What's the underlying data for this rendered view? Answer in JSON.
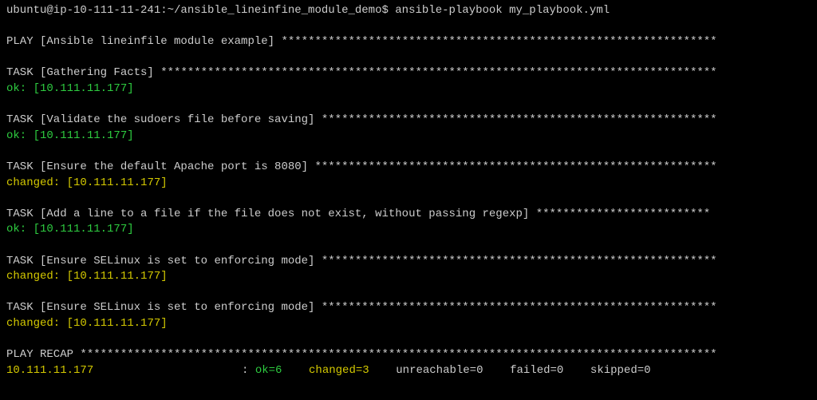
{
  "prompt": "ubuntu@ip-10-111-11-241:~/ansible_lineinfine_module_demo$ ansible-playbook my_playbook.yml",
  "play": {
    "label": "PLAY [Ansible lineinfile module example] ",
    "stars": "*****************************************************************"
  },
  "tasks": [
    {
      "label": "TASK [Gathering Facts] ",
      "stars": "***********************************************************************************",
      "status": "ok",
      "host": "[10.111.11.177]"
    },
    {
      "label": "TASK [Validate the sudoers file before saving] ",
      "stars": "***********************************************************",
      "status": "ok",
      "host": "[10.111.11.177]"
    },
    {
      "label": "TASK [Ensure the default Apache port is 8080] ",
      "stars": "************************************************************",
      "status": "changed",
      "host": "[10.111.11.177]"
    },
    {
      "label": "TASK [Add a line to a file if the file does not exist, without passing regexp] ",
      "stars": "**************************",
      "status": "ok",
      "host": "[10.111.11.177]"
    },
    {
      "label": "TASK [Ensure SELinux is set to enforcing mode] ",
      "stars": "***********************************************************",
      "status": "changed",
      "host": "[10.111.11.177]"
    },
    {
      "label": "TASK [Ensure SELinux is set to enforcing mode] ",
      "stars": "***********************************************************",
      "status": "changed",
      "host": "[10.111.11.177]"
    }
  ],
  "recap": {
    "label": "PLAY RECAP ",
    "stars": "***********************************************************************************************",
    "host": "10.111.11.177",
    "sep": ": ",
    "ok": "ok=6",
    "changed": "changed=3",
    "unreachable": "unreachable=0",
    "failed": "failed=0",
    "skipped": "skipped=0"
  },
  "status_labels": {
    "ok": "ok: ",
    "changed": "changed: "
  }
}
